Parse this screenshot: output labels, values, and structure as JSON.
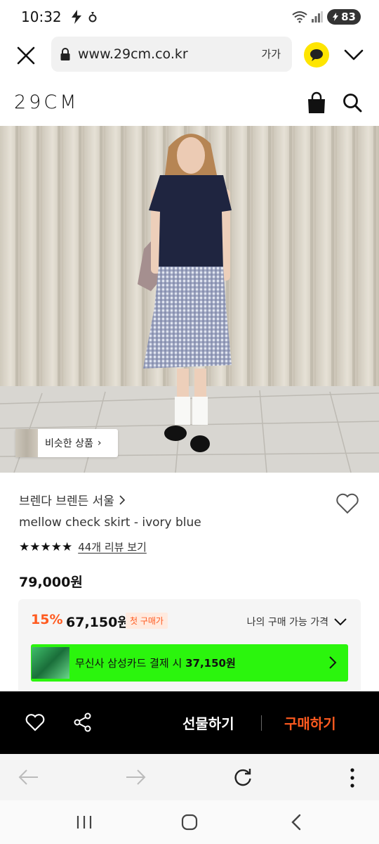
{
  "status_bar": {
    "time": "10:32",
    "battery": "83",
    "icons": [
      "bolt-icon",
      "notification-icon",
      "wifi-icon",
      "signal-icon",
      "battery-icon"
    ]
  },
  "browser": {
    "url": "www.29cm.co.kr",
    "font_size_button": "가가"
  },
  "site": {
    "logo": "29CM"
  },
  "product": {
    "similar_button": "비슷한 상품",
    "brand": "브렌다 브렌든 서울",
    "name": "mellow check skirt - ivory blue",
    "stars": "★★★★★",
    "review_link": "44개 리뷰 보기",
    "price": "79,000원"
  },
  "discount": {
    "percent": "15%",
    "price": "67,150원",
    "badge": "첫 구매가",
    "my_price_label": "나의 구매 가능 가격",
    "card_text": "무신사 삼성카드 결제 시",
    "card_amount": "37,150원"
  },
  "actions": {
    "gift": "선물하기",
    "buy": "구매하기"
  },
  "colors": {
    "accent": "#ff5a1f",
    "card_banner": "#2bf50d",
    "kakao": "#fee500"
  }
}
